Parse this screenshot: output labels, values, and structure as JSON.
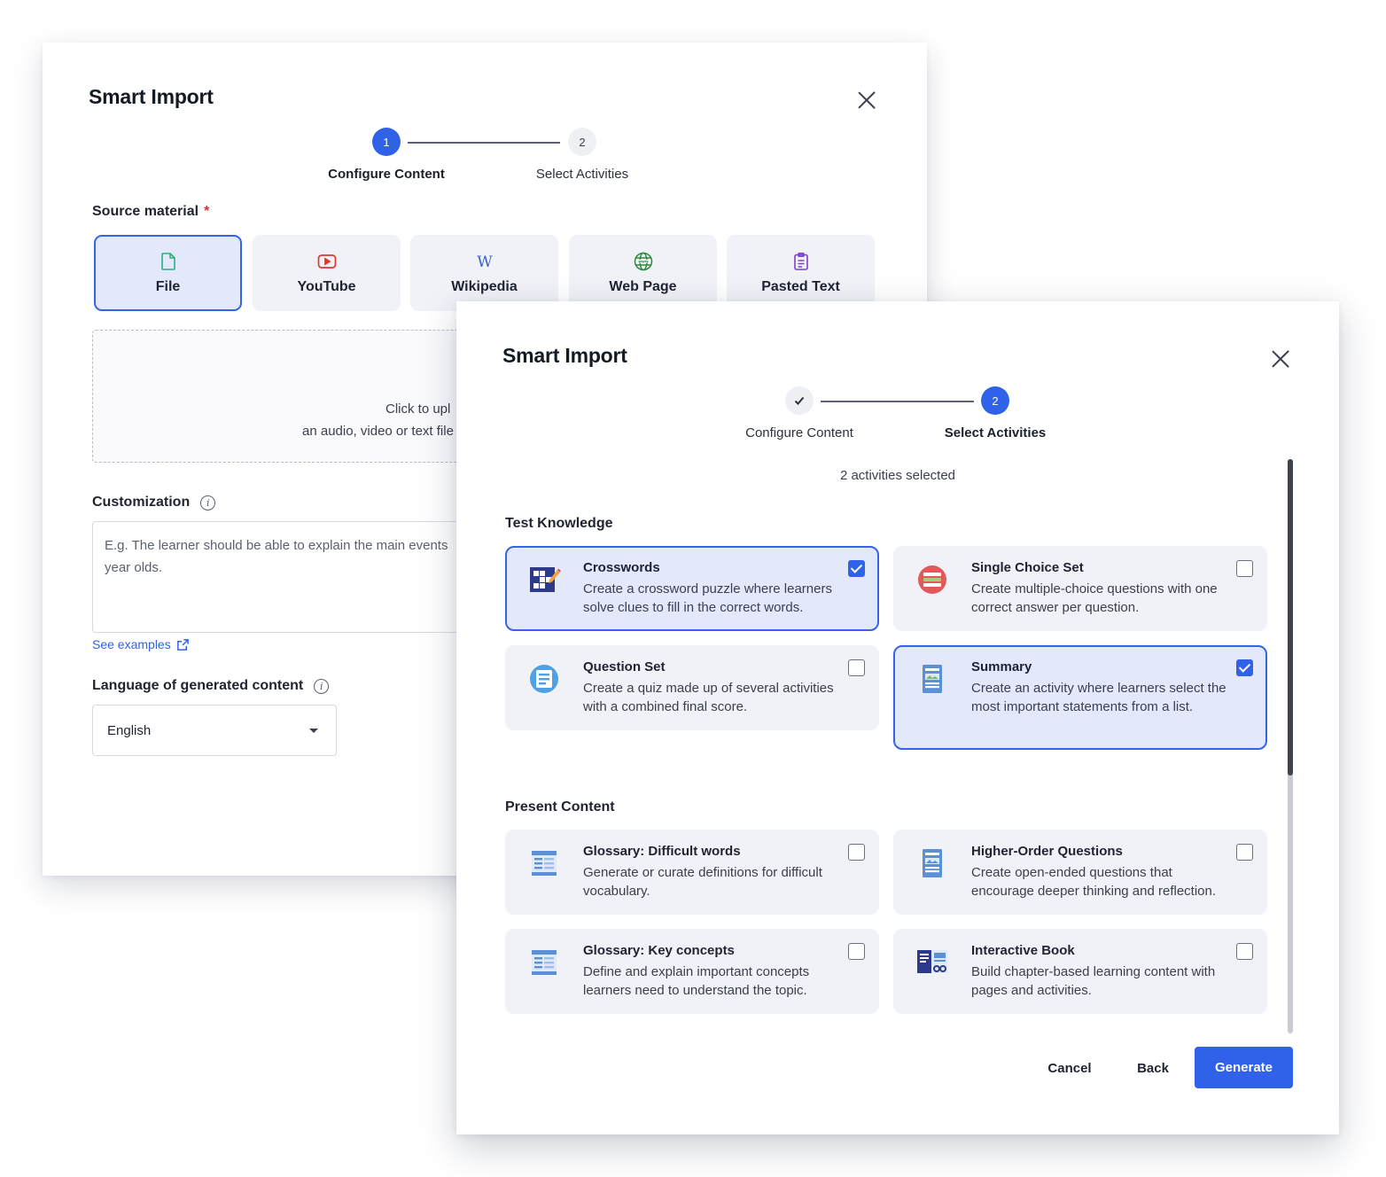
{
  "back_modal": {
    "title": "Smart Import",
    "steps": [
      {
        "number": "1",
        "label": "Configure Content"
      },
      {
        "number": "2",
        "label": "Select Activities"
      }
    ],
    "source_label": "Source material",
    "required_mark": "*",
    "sources": [
      {
        "label": "File",
        "icon": "file-icon",
        "color": "#2fae7a"
      },
      {
        "label": "YouTube",
        "icon": "youtube-icon",
        "color": "#d83a2e"
      },
      {
        "label": "Wikipedia",
        "icon": "wikipedia-icon",
        "color": "#3a62c9"
      },
      {
        "label": "Web Page",
        "icon": "globe-www-icon",
        "color": "#2e8b3a"
      },
      {
        "label": "Pasted Text",
        "icon": "clipboard-icon",
        "color": "#7d3fc9"
      }
    ],
    "upload_line1": "Click to upl",
    "upload_line2": "an audio, video or text file",
    "customization_label": "Customization",
    "customization_placeholder": "E.g. The learner should be able to explain the main events year olds.",
    "customization_line1": "E.g. The learner should be able to explain the main events",
    "customization_line2": "year olds.",
    "see_examples": "See examples",
    "language_label": "Language of generated content",
    "language_value": "English"
  },
  "front_modal": {
    "title": "Smart Import",
    "steps": [
      {
        "label": "Configure Content"
      },
      {
        "number": "2",
        "label": "Select Activities"
      }
    ],
    "counter": "2 activities selected",
    "groups": [
      {
        "title": "Test Knowledge",
        "items": [
          {
            "title": "Crosswords",
            "description": "Create a crossword puzzle where learners solve clues to fill in the correct words.",
            "checked": true,
            "icon": "crossword-icon"
          },
          {
            "title": "Single Choice Set",
            "description": "Create multiple-choice questions with one correct answer per question.",
            "checked": false,
            "icon": "single-choice-icon"
          },
          {
            "title": "Question Set",
            "description": "Create a quiz made up of several activities with a combined final score.",
            "checked": false,
            "icon": "question-set-icon"
          },
          {
            "title": "Summary",
            "description": "Create an activity where learners select the most important statements from a list.",
            "checked": true,
            "icon": "summary-icon"
          }
        ]
      },
      {
        "title": "Present Content",
        "items": [
          {
            "title": "Glossary: Difficult words",
            "description": "Generate or curate definitions for difficult vocabulary.",
            "checked": false,
            "icon": "glossary-icon"
          },
          {
            "title": "Higher-Order Questions",
            "description": "Create open-ended questions that encourage deeper thinking and reflection.",
            "checked": false,
            "icon": "higher-order-icon"
          },
          {
            "title": "Glossary: Key concepts",
            "description": "Define and explain important concepts learners need to understand the topic.",
            "checked": false,
            "icon": "glossary-icon"
          },
          {
            "title": "Interactive Book",
            "description": "Build chapter-based learning content with pages and activities.",
            "checked": false,
            "icon": "interactive-book-icon"
          }
        ]
      }
    ],
    "buttons": {
      "cancel": "Cancel",
      "back": "Back",
      "generate": "Generate"
    },
    "accent": "#2f62e8"
  }
}
